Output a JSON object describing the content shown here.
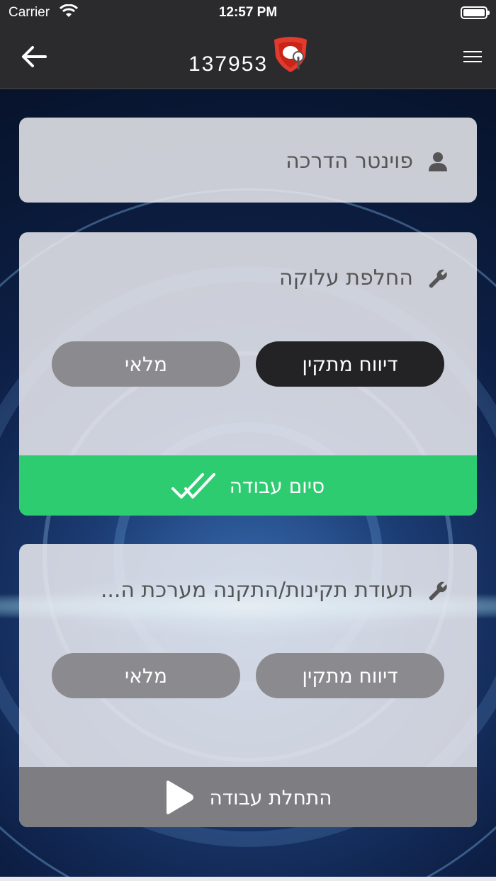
{
  "status_bar": {
    "carrier": "Carrier",
    "time": "12:57 PM"
  },
  "nav": {
    "title": "137953",
    "back_icon": "arrow-left-icon",
    "menu_icon": "hamburger-menu-icon",
    "logo": "shield-dog-logo"
  },
  "cards": [
    {
      "label": "פוינטר הדרכה",
      "icon": "user-icon"
    },
    {
      "label": "החלפת עלוקה",
      "icon": "wrench-icon",
      "buttons": [
        "דיווח מתקין",
        "מלאי"
      ],
      "footer": {
        "label": "סיום עבודה",
        "icon": "double-check-icon",
        "color": "#2ecc71"
      }
    },
    {
      "label": "תעודת תקינות/התקנה מערכת ה...",
      "icon": "wrench-icon",
      "buttons": [
        "דיווח מתקין",
        "מלאי"
      ],
      "footer": {
        "label": "התחלת עבודה",
        "icon": "play-icon",
        "color": "#7d7d82"
      }
    }
  ],
  "colors": {
    "bar": "#2b2b2d",
    "success": "#2ecc71",
    "pill_dark": "#232325",
    "pill_gray": "#8b8b8f"
  }
}
